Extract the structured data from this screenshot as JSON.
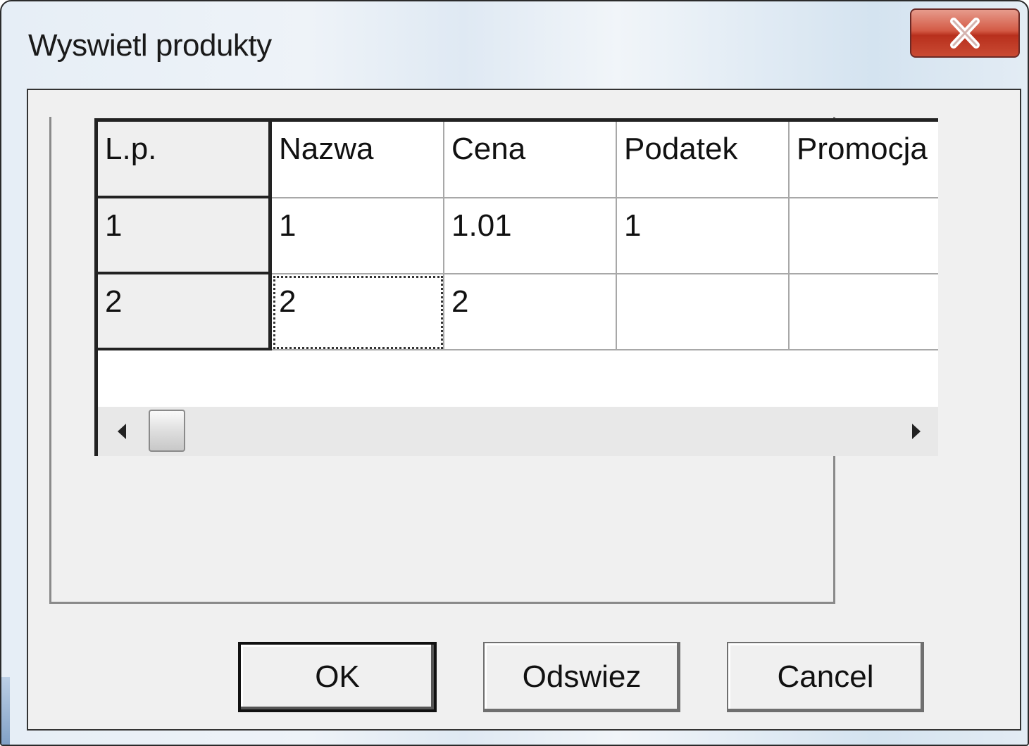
{
  "window": {
    "title": "Wyswietl produkty",
    "close_glyph": "X"
  },
  "grid": {
    "corner_label": "L.p.",
    "columns": [
      "Nazwa",
      "Cena",
      "Podatek",
      "Promocja"
    ],
    "rows": [
      {
        "lp": "1",
        "cells": [
          "1",
          "1.01",
          "1",
          ""
        ]
      },
      {
        "lp": "2",
        "cells": [
          "2",
          "2",
          "",
          ""
        ]
      }
    ],
    "focused_cell": {
      "row": 1,
      "col": 0
    }
  },
  "buttons": {
    "ok": "OK",
    "refresh": "Odswiez",
    "cancel": "Cancel"
  },
  "icons": {
    "close": "close-icon",
    "scroll_left": "scroll-left-arrow-icon",
    "scroll_right": "scroll-right-arrow-icon"
  },
  "colors": {
    "close_button": "#c94a33",
    "dialog_face": "#f0f0f0",
    "title_glass": "#dfe9f3"
  }
}
